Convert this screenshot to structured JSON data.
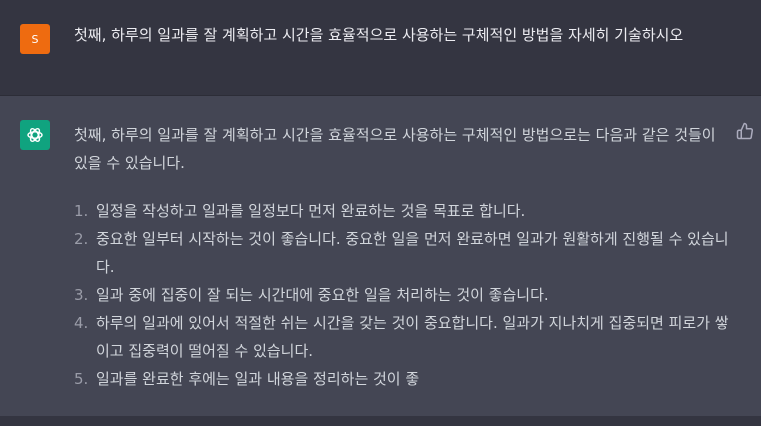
{
  "user": {
    "avatar_letter": "S",
    "message": "첫째, 하루의 일과를 잘 계획하고 시간을 효율적으로 사용하는 구체적인 방법을 자세히 기술하시오"
  },
  "assistant": {
    "intro": "첫째, 하루의 일과를 잘 계획하고 시간을 효율적으로 사용하는 구체적인 방법으로는 다음과 같은 것들이 있을 수 있습니다.",
    "items": [
      {
        "num": "1.",
        "text": "일정을 작성하고 일과를 일정보다 먼저 완료하는 것을 목표로 합니다."
      },
      {
        "num": "2.",
        "text": "중요한 일부터 시작하는 것이 좋습니다. 중요한 일을 먼저 완료하면 일과가 원활하게 진행될 수 있습니다."
      },
      {
        "num": "3.",
        "text": "일과 중에 집중이 잘 되는 시간대에 중요한 일을 처리하는 것이 좋습니다."
      },
      {
        "num": "4.",
        "text": "하루의 일과에 있어서 적절한 쉬는 시간을 갖는 것이 중요합니다. 일과가 지나치게 집중되면 피로가 쌓이고 집중력이 떨어질 수 있습니다."
      },
      {
        "num": "5.",
        "text": "일과를 완료한 후에는 일과 내용을 정리하는 것이 좋"
      }
    ]
  },
  "colors": {
    "user_bg": "#343541",
    "assistant_bg": "#444654",
    "user_avatar": "#ee6b10",
    "bot_avatar": "#10a37f"
  },
  "icons": {
    "bot_avatar": "openai-logo-icon",
    "feedback": "thumbs-up-icon"
  }
}
